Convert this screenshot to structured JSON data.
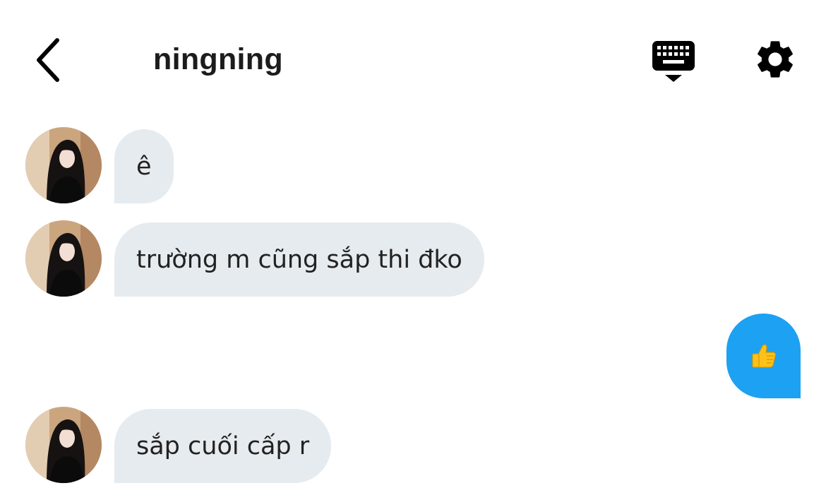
{
  "header": {
    "title": "ningning"
  },
  "messages": [
    {
      "direction": "incoming",
      "text": "ê"
    },
    {
      "direction": "incoming",
      "text": "trường m cũng sắp thi đko"
    },
    {
      "direction": "outgoing",
      "content": "thumbs-up"
    },
    {
      "direction": "incoming",
      "text": "sắp cuối cấp r"
    }
  ],
  "colors": {
    "incoming_bubble": "#e6ebef",
    "outgoing_bubble": "#1da1f2",
    "icon": "#000000"
  },
  "icons": [
    "back-chevron-icon",
    "keyboard-icon",
    "settings-gear-icon",
    "thumbs-up-icon"
  ]
}
